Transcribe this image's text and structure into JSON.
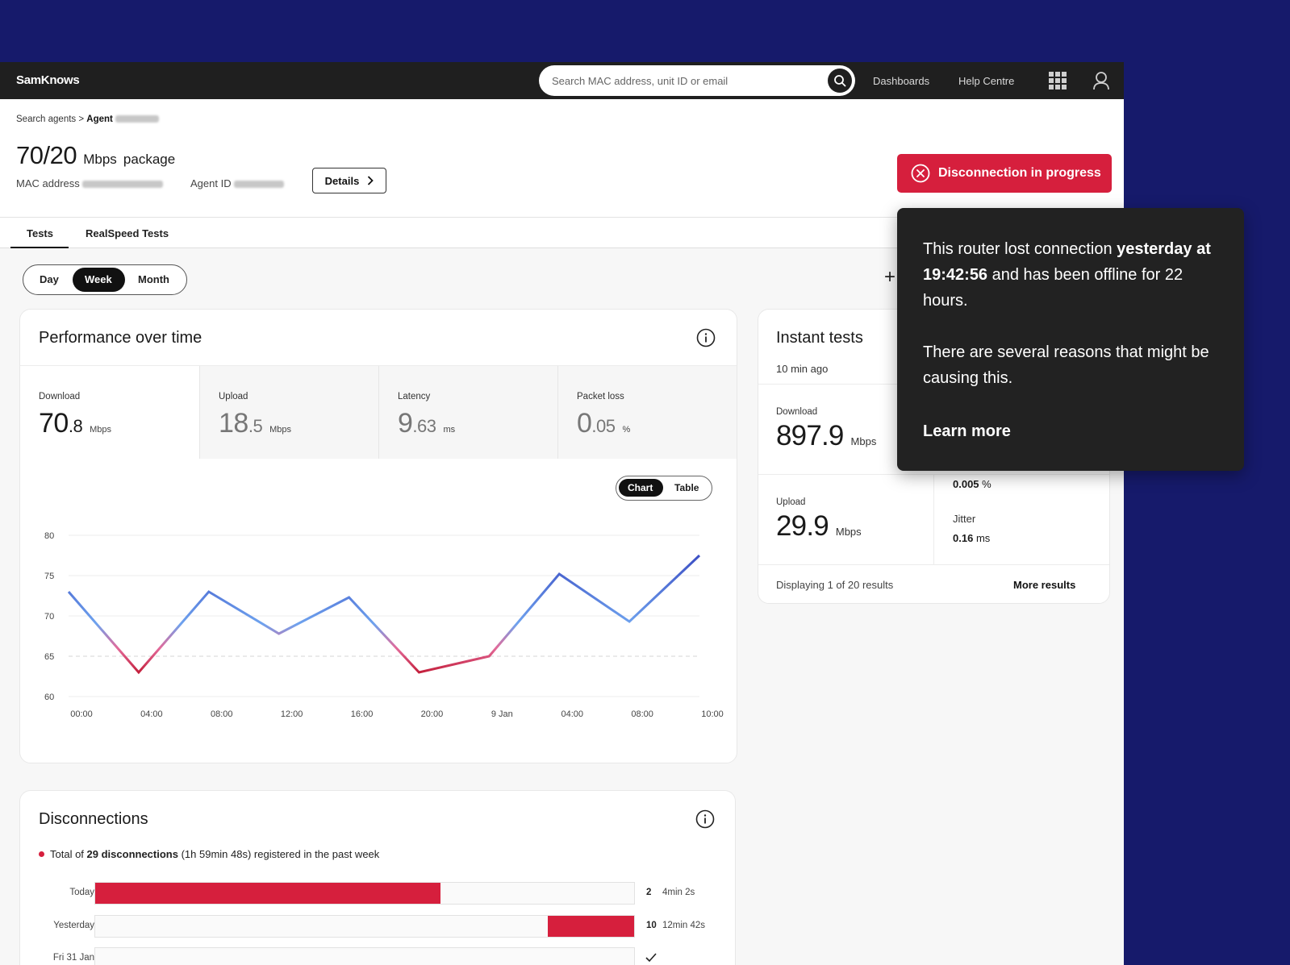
{
  "app": {
    "logo": "SamKnows"
  },
  "topbar": {
    "search_placeholder": "Search MAC address, unit ID or email",
    "nav": [
      "Dashboards",
      "Help Centre"
    ]
  },
  "breadcrumb": {
    "parent": "Search agents",
    "separator": ">",
    "current": "Agent"
  },
  "package": {
    "speed": "70/20",
    "unit": "Mbps",
    "word": "package"
  },
  "meta": {
    "mac_label": "MAC address",
    "agent_label": "Agent ID"
  },
  "details_label": "Details",
  "disconnection_button": "Disconnection in progress",
  "tabs": [
    "Tests",
    "RealSpeed Tests"
  ],
  "periods": {
    "day": "Day",
    "week": "Week",
    "month": "Month",
    "selected": "Week"
  },
  "performance": {
    "title": "Performance over time",
    "metrics": [
      {
        "label": "Download",
        "int": "70",
        "dec": ".8",
        "unit": "Mbps"
      },
      {
        "label": "Upload",
        "int": "18",
        "dec": ".5",
        "unit": "Mbps"
      },
      {
        "label": "Latency",
        "int": "9",
        "dec": ".63",
        "unit": "ms"
      },
      {
        "label": "Packet loss",
        "int": "0",
        "dec": ".05",
        "unit": "%"
      }
    ],
    "view_toggle": {
      "chart": "Chart",
      "table": "Table",
      "selected": "Chart"
    }
  },
  "chart_data": {
    "type": "line",
    "x": [
      "00:00",
      "04:00",
      "08:00",
      "12:00",
      "16:00",
      "20:00",
      "9 Jan",
      "04:00",
      "08:00",
      "10:00"
    ],
    "points": [
      {
        "x": "00:00",
        "y": 73.0
      },
      {
        "x": "04:00",
        "y": 63.0
      },
      {
        "x": "08:00",
        "y": 73.0
      },
      {
        "x": "12:00",
        "y": 67.8
      },
      {
        "x": "16:00",
        "y": 72.3
      },
      {
        "x": "20:00",
        "y": 63.0
      },
      {
        "x": "9 Jan",
        "y": 65.0
      },
      {
        "x": "04:00",
        "y": 75.2
      },
      {
        "x": "08:00",
        "y": 69.3
      },
      {
        "x": "10:00",
        "y": 77.5
      }
    ],
    "yticks": [
      80,
      75,
      70,
      65,
      60
    ],
    "ylim": [
      60,
      80
    ],
    "threshold": 65,
    "grid": true,
    "colors": {
      "good": "#2e37b8",
      "mid": "#6ea2ee",
      "bad": "#c4203c",
      "threshold": "#d6d6d6"
    }
  },
  "instant_tests": {
    "title": "Instant tests",
    "age": "10 min ago",
    "download": {
      "label": "Download",
      "value": "897.9",
      "unit": "Mbps"
    },
    "upload": {
      "label": "Upload",
      "value": "29.9",
      "unit": "Mbps"
    },
    "packet_loss": {
      "value": "0.005",
      "unit": "%"
    },
    "jitter": {
      "label": "Jitter",
      "value": "0.16",
      "unit": "ms"
    },
    "footer": "Displaying 1 of 20 results",
    "more": "More results"
  },
  "tooltip": {
    "line1_pre": "This router lost connection",
    "line1_bold": "yesterday at 19:42:56",
    "line1_post": "and has been offline for 22 hours.",
    "line2": "There are several reasons that might be causing this.",
    "link": "Learn more"
  },
  "disconnections": {
    "title": "Disconnections",
    "summary_pre": "Total of",
    "summary_bold": "29 disconnections",
    "summary_post": "(1h 59min 48s) registered in the past week",
    "rows": [
      {
        "label": "Today",
        "count": "2",
        "duration": "4min 2s",
        "fill_from": 0,
        "fill_to": 0.64
      },
      {
        "label": "Yesterday",
        "count": "10",
        "duration": "12min 42s",
        "fill_from": 0.84,
        "fill_to": 1.0
      },
      {
        "label": "Fri 31 Jan",
        "count": "",
        "duration": "",
        "fill_from": 0,
        "fill_to": 0
      }
    ]
  },
  "colors": {
    "brand_bg": "#161a6b",
    "alert": "#d61f3d",
    "dark": "#1f1f1f"
  }
}
